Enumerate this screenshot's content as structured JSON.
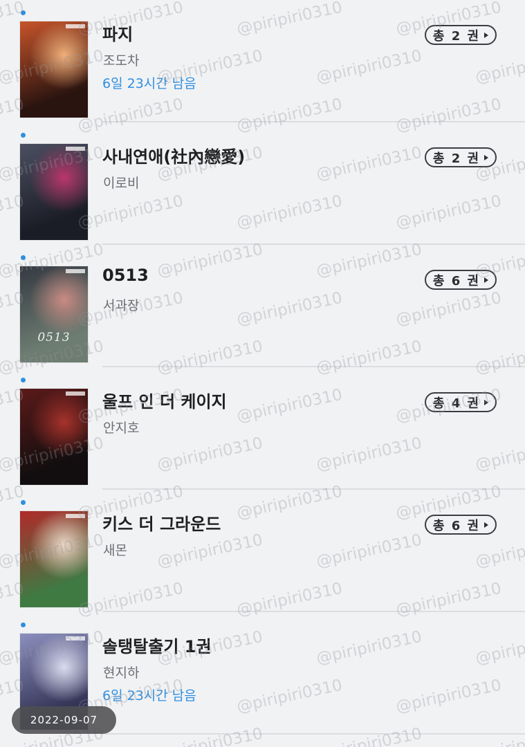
{
  "books": [
    {
      "title": "파지",
      "author": "조도차",
      "remaining": "6일 23시간 남음",
      "count_label": "총 2 권",
      "cover_text": "",
      "cover_colors": [
        "#2a1410",
        "#c7542a",
        "#efb07a"
      ],
      "has_count": true
    },
    {
      "title": "사내연애(社內戀愛)",
      "author": "이로비",
      "remaining": "",
      "count_label": "총 2 권",
      "cover_text": "",
      "cover_colors": [
        "#1b1d26",
        "#4b4f61",
        "#b9366b"
      ],
      "has_count": true
    },
    {
      "title": "0513",
      "author": "서과장",
      "remaining": "",
      "count_label": "총 6 권",
      "cover_text": "0513",
      "cover_colors": [
        "#6d7d72",
        "#353a42",
        "#c98b83"
      ],
      "has_count": true
    },
    {
      "title": "울프 인 더 케이지",
      "author": "안지호",
      "remaining": "",
      "count_label": "총 4 권",
      "cover_text": "",
      "cover_colors": [
        "#120e0f",
        "#5b1a1a",
        "#a7322b"
      ],
      "has_count": true
    },
    {
      "title": "키스 더 그라운드",
      "author": "새몬",
      "remaining": "",
      "count_label": "총 6 권",
      "cover_text": "",
      "cover_colors": [
        "#3f7a43",
        "#b02a2a",
        "#e9d6c5"
      ],
      "has_count": true
    },
    {
      "title": "솔탱탈출기 1권",
      "author": "현지하",
      "remaining": "6일 23시간 남음",
      "count_label": "",
      "cover_text": "",
      "cover_colors": [
        "#343456",
        "#8c8fbe",
        "#d9dcef"
      ],
      "has_count": false
    }
  ],
  "watermark": "@piripiri0310",
  "date_label": "2022-09-07",
  "colors": {
    "accent": "#2f8fe0",
    "background": "#f1f2f4",
    "title": "#1f1f22",
    "author": "#6b6e73"
  }
}
